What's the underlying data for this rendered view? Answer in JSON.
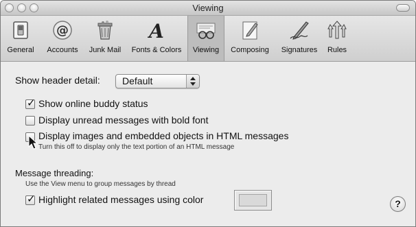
{
  "window": {
    "title": "Viewing"
  },
  "toolbar": {
    "items": [
      {
        "label": "General",
        "icon": "general-switch-icon"
      },
      {
        "label": "Accounts",
        "icon": "at-sign-icon"
      },
      {
        "label": "Junk Mail",
        "icon": "trash-can-icon"
      },
      {
        "label": "Fonts & Colors",
        "icon": "font-letter-a-icon"
      },
      {
        "label": "Viewing",
        "icon": "glasses-icon",
        "selected": true
      },
      {
        "label": "Composing",
        "icon": "pencil-paper-icon"
      },
      {
        "label": "Signatures",
        "icon": "pen-signature-icon"
      },
      {
        "label": "Rules",
        "icon": "rules-arrows-icon"
      }
    ]
  },
  "header_detail": {
    "label": "Show header detail:",
    "value": "Default"
  },
  "options": [
    {
      "label": "Show online buddy status",
      "checked": true
    },
    {
      "label": "Display unread messages with bold font",
      "checked": false
    },
    {
      "label": "Display images and embedded objects in HTML messages",
      "checked": false,
      "hint": "Turn this off to display only the text portion of an HTML message"
    }
  ],
  "threading": {
    "heading": "Message threading:",
    "hint": "Use the View menu to group messages by thread",
    "highlight_label": "Highlight related messages using color",
    "highlight_checked": true,
    "highlight_color": "#d9d9d9"
  },
  "help": {
    "glyph": "?"
  }
}
